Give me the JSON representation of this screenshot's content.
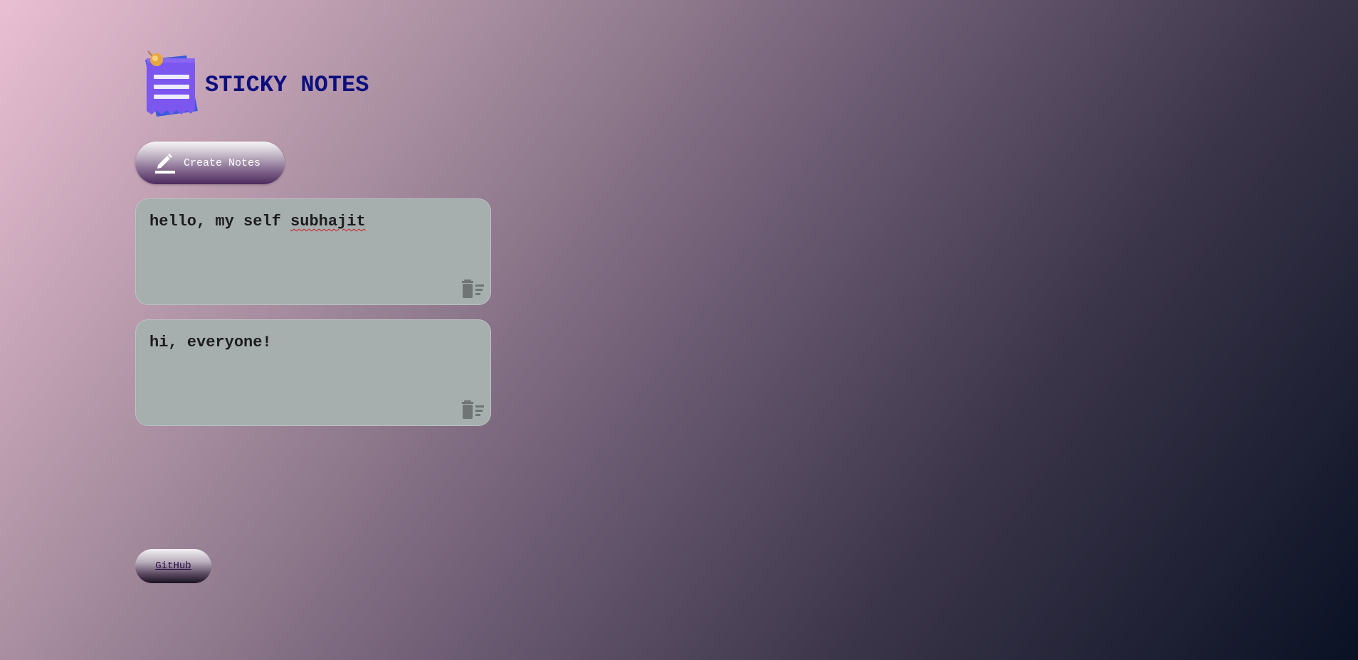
{
  "header": {
    "logo_icon": "sticky-note-pin-icon",
    "title": "STICKY NOTES"
  },
  "create_button": {
    "icon": "pencil-icon",
    "label": "Create Notes"
  },
  "notes": [
    {
      "text_before": "hello, my self ",
      "text_misspelled": "subhajit",
      "delete_icon": "trash-list-icon"
    },
    {
      "text_before": "hi, everyone!",
      "text_misspelled": "",
      "delete_icon": "trash-list-icon"
    }
  ],
  "footer": {
    "github_label": "GitHub"
  },
  "colors": {
    "title": "#0e0f7e",
    "note_bg": "#a6aeae",
    "spellcheck": "#d21b1b"
  }
}
